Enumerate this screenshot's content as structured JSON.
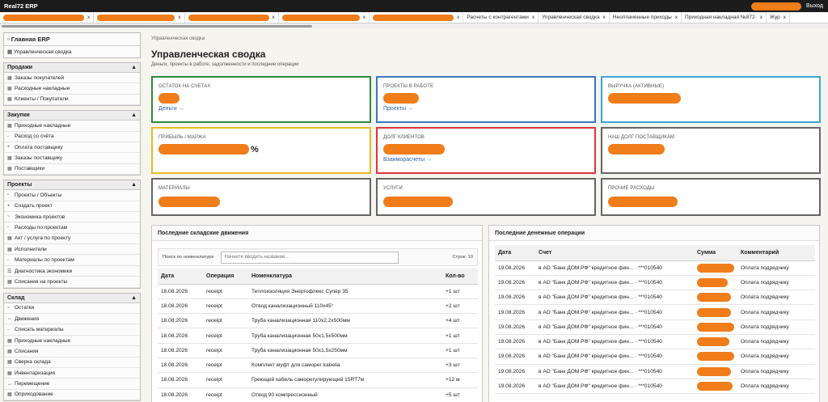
{
  "app": {
    "title": "Real72 ERP",
    "logout": "Выход"
  },
  "tabs": [
    {
      "label": "",
      "redacted": true,
      "w": 100
    },
    {
      "label": "",
      "redacted": true,
      "w": 96
    },
    {
      "label": "",
      "redacted": true,
      "w": 100
    },
    {
      "label": "",
      "redacted": true,
      "w": 96
    },
    {
      "label": "",
      "redacted": true,
      "w": 100
    },
    {
      "label": "Расчеты с контрагентами",
      "redacted": false
    },
    {
      "label": "Управленческая сводка",
      "redacted": false
    },
    {
      "label": "Неоплаченные приходы",
      "redacted": false
    },
    {
      "label": "Приходная накладная №872-",
      "redacted": false
    },
    {
      "label": "Жур",
      "redacted": false
    }
  ],
  "tab_close": "x",
  "sidebar": {
    "home": {
      "title": "Главная ERP",
      "item": "Управленческая сводка",
      "item_icon": "▦"
    },
    "sections": [
      {
        "title": "Продажи",
        "toggle": "▲",
        "items": [
          {
            "icon": "▦",
            "label": "Заказы покупателей"
          },
          {
            "icon": "▦",
            "label": "Расходные накладные"
          },
          {
            "icon": "▦",
            "label": "Клиенты / Покупатели"
          }
        ]
      },
      {
        "title": "Закупки",
        "toggle": "▲",
        "items": [
          {
            "icon": "▦",
            "label": "Приходные накладные"
          },
          {
            "icon": "-",
            "label": "Расход со счёта"
          },
          {
            "icon": "+",
            "label": "Оплата поставщику"
          },
          {
            "icon": "▦",
            "label": "Заказы поставщику"
          },
          {
            "icon": "▦",
            "label": "Поставщики"
          }
        ]
      },
      {
        "title": "Проекты",
        "toggle": "▲",
        "items": [
          {
            "icon": "▫",
            "label": "Проекты / Объекты"
          },
          {
            "icon": "+",
            "label": "Создать проект"
          },
          {
            "icon": "~",
            "label": "Экономика проектов"
          },
          {
            "icon": "-",
            "label": "Расходы по проектам"
          },
          {
            "icon": "▦",
            "label": "Акт / услуга по проекту"
          },
          {
            "icon": "▦",
            "label": "Исполнители"
          },
          {
            "icon": "-",
            "label": "Материалы по проектам"
          },
          {
            "icon": "☰",
            "label": "Диагностика экономики"
          },
          {
            "icon": "▦",
            "label": "Списания на проекты"
          }
        ]
      },
      {
        "title": "Склад",
        "toggle": "▲",
        "items": [
          {
            "icon": "~",
            "label": "Остатки"
          },
          {
            "icon": "↔",
            "label": "Движения"
          },
          {
            "icon": "-",
            "label": "Списать материалы"
          },
          {
            "icon": "▦",
            "label": "Приходные накладные"
          },
          {
            "icon": "▦",
            "label": "Списания"
          },
          {
            "icon": "▦",
            "label": "Сверка склада"
          },
          {
            "icon": "▦",
            "label": "Инвентаризация"
          },
          {
            "icon": "↔",
            "label": "Перемещение"
          },
          {
            "icon": "▦",
            "label": "Оприходование"
          }
        ]
      }
    ]
  },
  "main": {
    "breadcrumb": "Управленческая сводка",
    "title": "Управленческая сводка",
    "subtitle": "Деньги, проекты в работе, задолженности и последние операции",
    "cards": [
      {
        "label": "ОСТАТОК НА СЧЕТАХ",
        "border": "#2e8b3e",
        "link": "Деньги →",
        "pill_w": 26
      },
      {
        "label": "ПРОЕКТЫ В РАБОТЕ",
        "border": "#3a78c8",
        "link": "Проекты →",
        "pill_w": 44
      },
      {
        "label": "ВЫРУЧКА (АКТИВНЫЕ)",
        "border": "#3aa6d8",
        "link": "",
        "pill_w": 90
      },
      {
        "label": "ПРИБЫЛЬ / МАРЖА",
        "border": "#e8b828",
        "link": "",
        "pill_w": 112,
        "suffix": "%"
      },
      {
        "label": "ДОЛГ КЛИЕНТОВ",
        "border": "#d8363e",
        "link": "Взаиморасчеты →",
        "pill_w": 76
      },
      {
        "label": "НАШ ДОЛГ ПОСТАВЩИКАМ",
        "border": "#666666",
        "link": "",
        "pill_w": 70
      },
      {
        "label": "МАТЕРИАЛЫ",
        "border": "#666666",
        "link": "",
        "pill_w": 76
      },
      {
        "label": "УСЛУГИ",
        "border": "#666666",
        "link": "",
        "pill_w": 86
      },
      {
        "label": "ПРОЧИЕ РАСХОДЫ",
        "border": "#666666",
        "link": "",
        "pill_w": 86
      }
    ],
    "stock": {
      "title": "Последние складские движения",
      "filter_label": "Поиск по номенклатуре",
      "filter_placeholder": "Начните вводить название...",
      "rows_label": "Строк: 10",
      "columns": [
        "Дата",
        "Операция",
        "Номенклатура",
        "Кол-во"
      ],
      "rows": [
        [
          "18.08.2026",
          "receipt",
          "Теплоизоляция Энергофлекс Супер 35",
          "+1 шт"
        ],
        [
          "18.08.2026",
          "receipt",
          "Отвод канализационный 110х45°",
          "+2 шт"
        ],
        [
          "18.08.2026",
          "receipt",
          "Труба канализационная 110х2,2х500мм",
          "+4 шт"
        ],
        [
          "18.08.2026",
          "receipt",
          "Труба канализационная 50х1,5х500мм",
          "+1 шт"
        ],
        [
          "18.08.2026",
          "receipt",
          "Труба канализационная 50х1,5х250мм",
          "+1 шт"
        ],
        [
          "18.08.2026",
          "receipt",
          "Комплект муфт для саморег kabelia",
          "+3 шт"
        ],
        [
          "18.08.2026",
          "receipt",
          "Греющий кабель саморегулирующий 15RT7м",
          "+12 м"
        ],
        [
          "18.08.2026",
          "receipt",
          "Отвод 90 компрессионный",
          "+5 шт"
        ]
      ]
    },
    "money": {
      "title": "Последние денежные операции",
      "columns": [
        "Дата",
        "Счет",
        "Сумма",
        "Комментарий"
      ],
      "rows": [
        {
          "date": "19.08.2026",
          "account": "в АО \"Банк ДОМ.РФ\" кредитное фин... · ***010540",
          "comment": "Оплата подрядчику",
          "w": 46
        },
        {
          "date": "19.08.2026",
          "account": "в АО \"Банк ДОМ.РФ\" кредитное фин... · ***010540",
          "comment": "Оплата подрядчику",
          "w": 38
        },
        {
          "date": "19.08.2026",
          "account": "в АО \"Банк ДОМ.РФ\" кредитное фин... · ***010540",
          "comment": "Оплата подрядчику",
          "w": 42
        },
        {
          "date": "19.08.2026",
          "account": "в АО \"Банк ДОМ.РФ\" кредитное фин... · ***010540",
          "comment": "Оплата подрядчику",
          "w": 42
        },
        {
          "date": "19.08.2026",
          "account": "в АО \"Банк ДОМ.РФ\" кредитное фин... · ***010540",
          "comment": "Оплата подрядчику",
          "w": 46
        },
        {
          "date": "19.08.2026",
          "account": "в АО \"Банк ДОМ.РФ\" кредитное фин... · ***010540",
          "comment": "Оплата подрядчику",
          "w": 40
        },
        {
          "date": "19.08.2026",
          "account": "в АО \"Банк ДОМ.РФ\" кредитное фин... · ***010540",
          "comment": "Оплата подрядчику",
          "w": 46
        },
        {
          "date": "19.08.2026",
          "account": "в АО \"Банк ДОМ.РФ\" кредитное фин... · ***010540",
          "comment": "Оплата подрядчику",
          "w": 42
        },
        {
          "date": "19.08.2026",
          "account": "в АО \"Банк ДОМ.РФ\" кредитное фин... · ***010540",
          "comment": "Оплата подрядчику",
          "w": 44
        }
      ]
    },
    "colors": {
      "accent_orange": "#f07c1a",
      "link": "#2f5fa8"
    }
  }
}
